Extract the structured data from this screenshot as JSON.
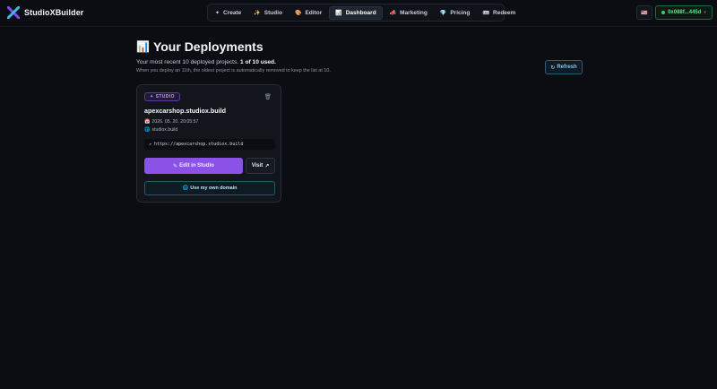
{
  "brand": {
    "name": "StudioXBuilder",
    "logo_icon": "x-logo-icon"
  },
  "nav": [
    {
      "icon": "✦",
      "icon_name": "sparkle-icon",
      "label": "Create",
      "active": false
    },
    {
      "icon": "✨",
      "icon_name": "sparkles-icon",
      "label": "Studio",
      "active": false
    },
    {
      "icon": "🎨",
      "icon_name": "palette-icon",
      "label": "Editor",
      "active": false
    },
    {
      "icon": "📊",
      "icon_name": "bar-chart-icon",
      "label": "Dashboard",
      "active": true
    },
    {
      "icon": "📣",
      "icon_name": "megaphone-icon",
      "label": "Marketing",
      "active": false
    },
    {
      "icon": "💎",
      "icon_name": "gem-icon",
      "label": "Pricing",
      "active": false
    },
    {
      "icon": "🎟",
      "icon_name": "ticket-icon",
      "label": "Redeem",
      "active": false
    }
  ],
  "header": {
    "flag": "🇺🇸",
    "wallet_label": "0x088f...445d",
    "wallet_chevron": "▾"
  },
  "page": {
    "title_icon": "📊",
    "title": "Your Deployments",
    "subtitle_prefix": "Your most recent 10 deployed projects.",
    "subtitle_usage": "1 of 10 used.",
    "note": "When you deploy an 11th, the oldest project is automatically removed to keep the list at 10.",
    "refresh_icon": "↻",
    "refresh_label": "Refresh"
  },
  "deployments": [
    {
      "badge_icon": "✦",
      "badge": "STUDIO",
      "delete_icon": "🗑",
      "name": "apexcarshop.studiox.build",
      "date_icon": "📅",
      "date": "2026. 05. 20. 20:05:57",
      "host_icon": "🌐",
      "host": "studiox.build",
      "url_icon": "↗",
      "url": "https://apexcarshop.studiox.build",
      "edit_icon": "✎",
      "edit_label": "Edit in Studio",
      "visit_label": "Visit",
      "visit_icon": "↗",
      "domain_icon": "🌐",
      "domain_label": "Use my own domain"
    }
  ],
  "colors": {
    "background": "#0b0d12",
    "accent_purple": "#8b52e8",
    "wallet_green": "#5fe38c",
    "refresh_blue": "#7cc6f2"
  }
}
